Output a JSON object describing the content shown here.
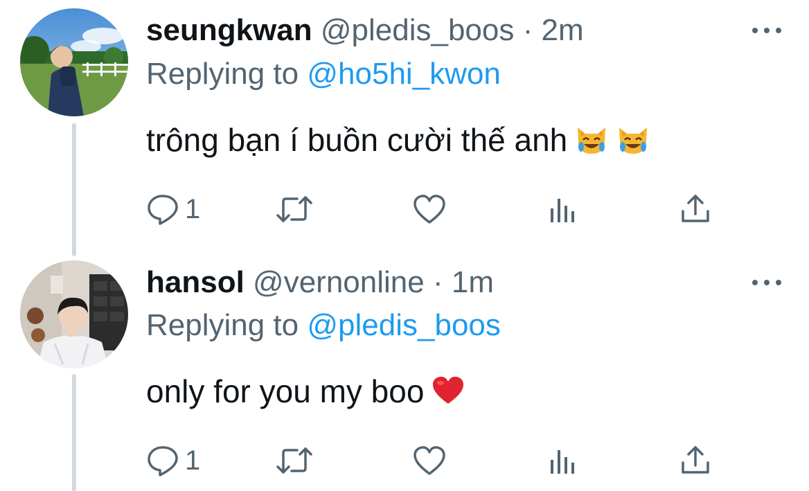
{
  "tweets": [
    {
      "display_name": "seungkwan",
      "handle": "@pledis_boos",
      "separator": "·",
      "time": "2m",
      "replying_prefix": "Replying to",
      "replying_mention": "@ho5hi_kwon",
      "text": "trông bạn í buồn cười thế anh",
      "emojis": [
        "crying-laughing-cat-emoji",
        "crying-laughing-cat-emoji"
      ],
      "reply_count": "1",
      "avatar": "avatar-seungkwan"
    },
    {
      "display_name": "hansol",
      "handle": "@vernonline",
      "separator": "·",
      "time": "1m",
      "replying_prefix": "Replying to",
      "replying_mention": "@pledis_boos",
      "text": "only for you my boo",
      "emojis": [
        "red-heart-emoji"
      ],
      "reply_count": "1",
      "avatar": "avatar-hansol"
    }
  ],
  "icons": {
    "reply": "reply-icon",
    "retweet": "retweet-icon",
    "like": "like-icon",
    "analytics": "analytics-icon",
    "share": "share-icon",
    "more": "more-icon"
  },
  "colors": {
    "text": "#0f1419",
    "secondary": "#536471",
    "link": "#1d9bf0",
    "thread_line": "#cfd9de"
  }
}
